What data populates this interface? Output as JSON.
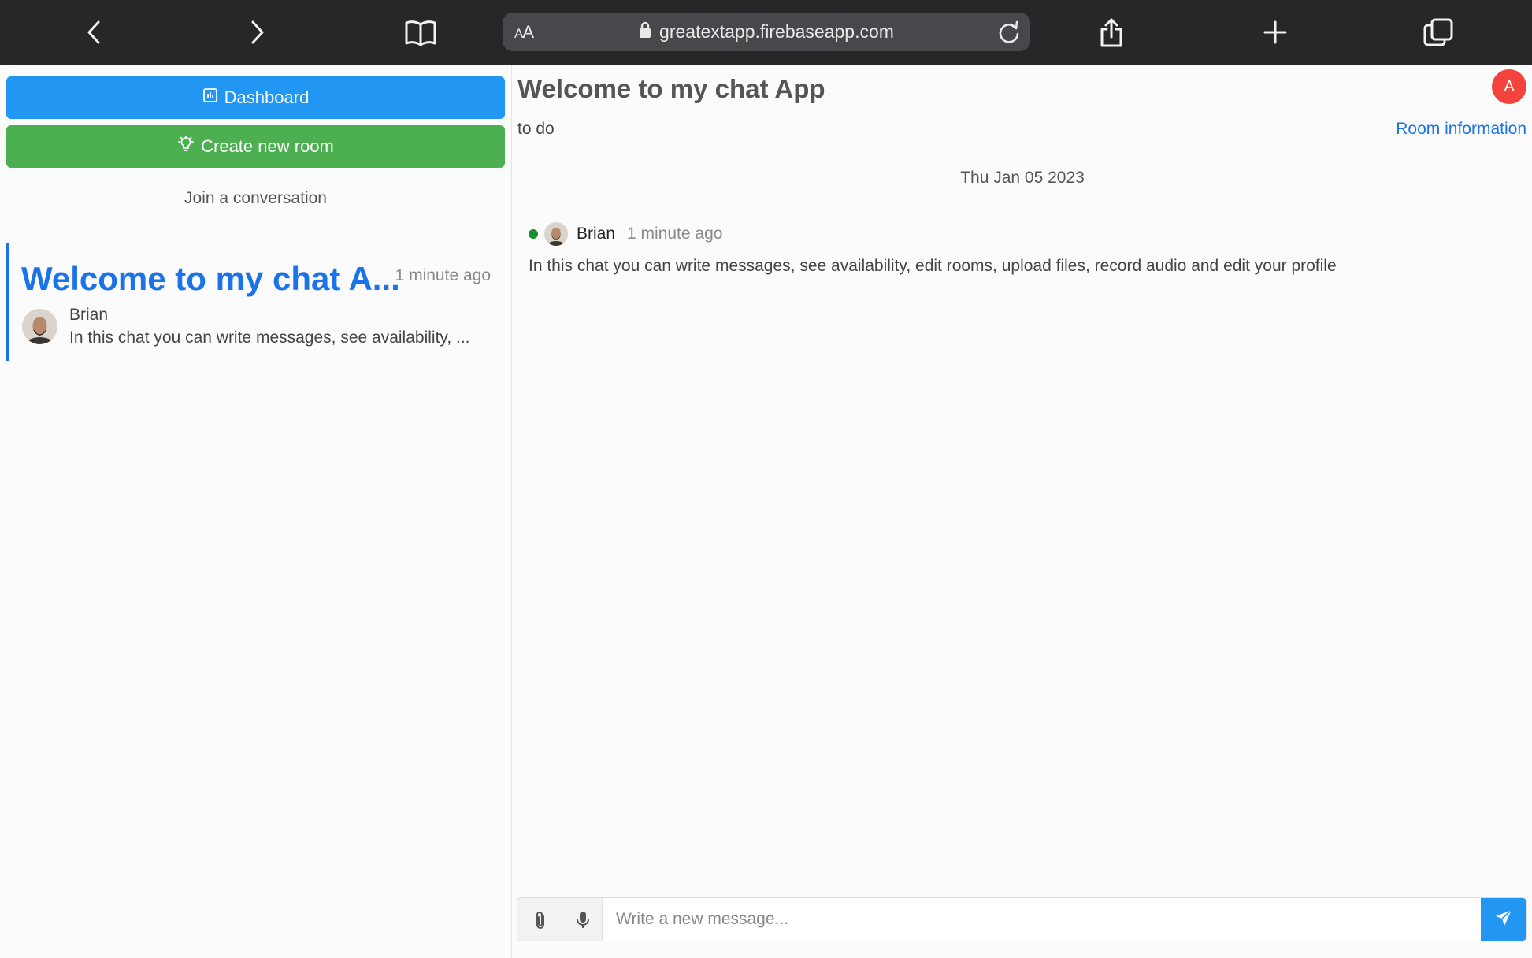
{
  "browser": {
    "address_text_size_label": "AA",
    "url": "greatextapp.firebaseapp.com",
    "icons": [
      "back-icon",
      "forward-icon",
      "bookmarks-icon",
      "lock-icon",
      "reload-icon",
      "share-icon",
      "new-tab-icon",
      "tabs-icon"
    ]
  },
  "sidebar": {
    "dashboard_label": "Dashboard",
    "create_room_label": "Create new room",
    "divider_label": "Join a conversation",
    "rooms": [
      {
        "title": "Welcome to my chat A...",
        "time": "1 minute ago",
        "last_user": "Brian",
        "last_message": "In this chat you can write messages, see availability, ..."
      }
    ]
  },
  "chat": {
    "title": "Welcome to my chat App",
    "description": "to do",
    "room_info_label": "Room information",
    "user_initial": "A",
    "date_separator": "Thu Jan 05 2023",
    "messages": [
      {
        "author": "Brian",
        "time": "1 minute ago",
        "online": true,
        "text": "In this chat you can write messages, see availability, edit rooms, upload files, record audio and edit your profile"
      }
    ]
  },
  "composer": {
    "placeholder": "Write a new message...",
    "icons": [
      "paperclip-icon",
      "microphone-icon",
      "send-icon"
    ]
  },
  "colors": {
    "primary_blue": "#2196f3",
    "link_blue": "#1a73e8",
    "success_green": "#4caf50",
    "online_green": "#1b8f2f",
    "avatar_red": "#f4433d",
    "toolbar_dark": "#27272a"
  }
}
